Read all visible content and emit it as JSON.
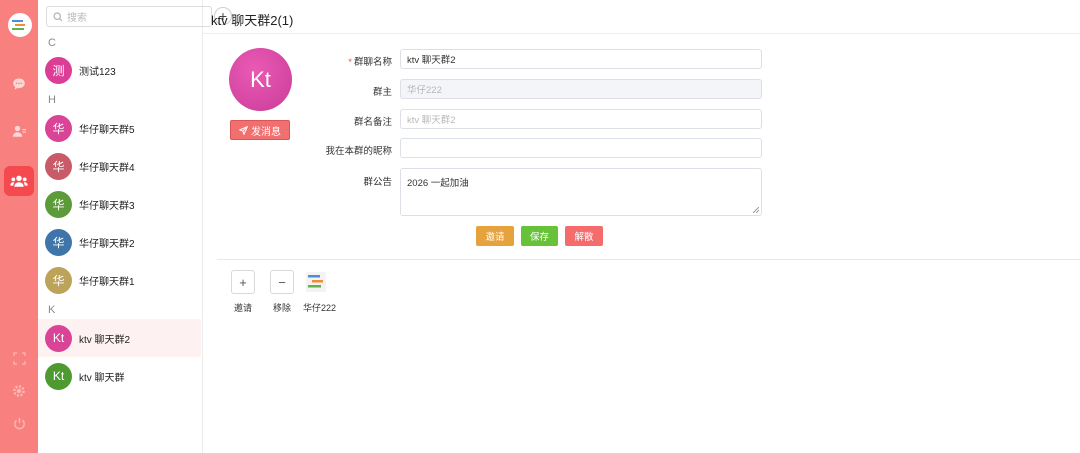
{
  "colors": {
    "rail": "#f8817f",
    "rail_active": "#f4494f",
    "accent_red": "#f26f6f",
    "invite_orange": "#e6a23c",
    "save_green": "#67c23a",
    "dismiss_red": "#f56c6c"
  },
  "rail": {
    "logo_icon": "app-logo-icon",
    "items": [
      {
        "icon": "chat-icon",
        "active": false
      },
      {
        "icon": "contacts-icon",
        "active": false
      },
      {
        "icon": "groups-icon",
        "active": true
      },
      {
        "icon": "fullscreen-icon",
        "active": false
      },
      {
        "icon": "settings-icon",
        "active": false
      },
      {
        "icon": "power-icon",
        "active": false
      }
    ]
  },
  "search": {
    "placeholder": "搜索"
  },
  "sections": {
    "c": "C",
    "h": "H",
    "k": "K"
  },
  "contacts": [
    {
      "initial": "测",
      "name": "测试123",
      "color": "#dc3e95"
    },
    {
      "initial": "华",
      "name": "华仔聊天群5",
      "color": "#d94497"
    },
    {
      "initial": "华",
      "name": "华仔聊天群4",
      "color": "#c95a68"
    },
    {
      "initial": "华",
      "name": "华仔聊天群3",
      "color": "#5d9b3a"
    },
    {
      "initial": "华",
      "name": "华仔聊天群2",
      "color": "#3f75a9"
    },
    {
      "initial": "华",
      "name": "华仔聊天群1",
      "color": "#bca35a"
    },
    {
      "initial": "Kt",
      "name": "ktv 聊天群2",
      "color": "#d94497"
    },
    {
      "initial": "Kt",
      "name": "ktv 聊天群",
      "color": "#4e9a31"
    }
  ],
  "header": {
    "title": "ktv 聊天群2(1)"
  },
  "profile": {
    "avatar_text": "Kt",
    "send_label": "发消息"
  },
  "form": {
    "name_label": "群聊名称",
    "name_value": "ktv 聊天群2",
    "owner_label": "群主",
    "owner_value": "华仔222",
    "remark_label": "群名备注",
    "remark_placeholder": "ktv 聊天群2",
    "nickname_label": "我在本群的昵称",
    "nickname_value": "",
    "notice_label": "群公告",
    "notice_value": "2026 一起加油"
  },
  "actions": {
    "invite": "邀请",
    "save": "保存",
    "dismiss": "解散"
  },
  "members": {
    "invite_label": "邀请",
    "remove_label": "移除",
    "member_name": "华仔222"
  }
}
